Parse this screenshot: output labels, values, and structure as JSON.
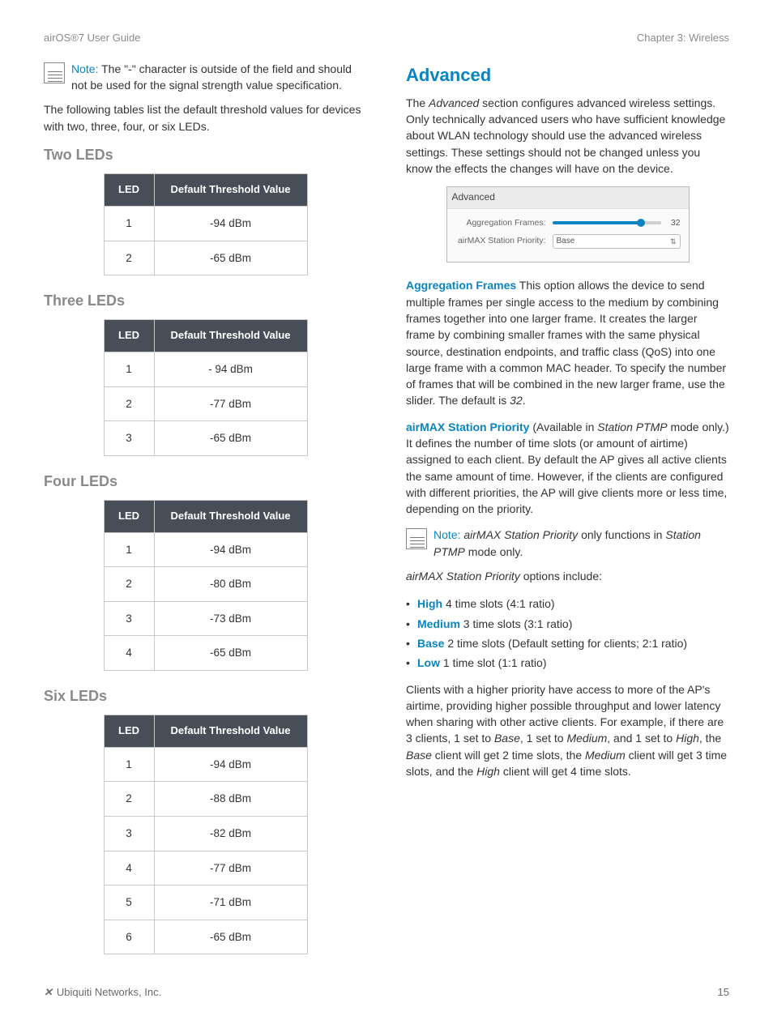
{
  "header": {
    "left": "airOS®7 User Guide",
    "right": "Chapter 3: Wireless"
  },
  "left": {
    "note1_label": "Note:",
    "note1": " The \"-\" character is outside of the field and should not be used for the signal strength value specification.",
    "intro": "The following tables list the default threshold values for devices with two, three, four, or six LEDs.",
    "two_title": "Two LEDs",
    "three_title": "Three LEDs",
    "four_title": "Four LEDs",
    "six_title": "Six LEDs",
    "col_led": "LED",
    "col_val": "Default Threshold Value",
    "two": [
      {
        "led": "1",
        "val": "-94 dBm"
      },
      {
        "led": "2",
        "val": "-65 dBm"
      }
    ],
    "three": [
      {
        "led": "1",
        "val": "- 94 dBm"
      },
      {
        "led": "2",
        "val": "-77 dBm"
      },
      {
        "led": "3",
        "val": "-65 dBm"
      }
    ],
    "four": [
      {
        "led": "1",
        "val": "-94 dBm"
      },
      {
        "led": "2",
        "val": "-80 dBm"
      },
      {
        "led": "3",
        "val": "-73 dBm"
      },
      {
        "led": "4",
        "val": "-65 dBm"
      }
    ],
    "six": [
      {
        "led": "1",
        "val": "-94 dBm"
      },
      {
        "led": "2",
        "val": "-88 dBm"
      },
      {
        "led": "3",
        "val": "-82 dBm"
      },
      {
        "led": "4",
        "val": "-77 dBm"
      },
      {
        "led": "5",
        "val": "-71 dBm"
      },
      {
        "led": "6",
        "val": "-65 dBm"
      }
    ]
  },
  "right": {
    "title": "Advanced",
    "intro_a": "The ",
    "intro_em": "Advanced",
    "intro_b": " section configures advanced wireless settings. Only technically advanced users who have sufficient knowledge about WLAN technology should use the advanced wireless settings. These settings should not be changed unless you know the effects the changes will have on the device.",
    "sc": {
      "title": "Advanced",
      "agg_label": "Aggregation Frames:",
      "agg_val": "32",
      "prio_label": "airMAX Station Priority:",
      "prio_val": "Base"
    },
    "agg_label": "Aggregation Frames",
    "agg_desc_a": "  This option allows the device to send multiple frames per single access to the medium by combining frames together into one larger frame. It creates the larger frame by combining smaller frames with the same physical source, destination endpoints, and traffic class (QoS) into one large frame with a common MAC header. To specify the number of frames that will be combined in the new larger frame, use the slider. The default is ",
    "agg_desc_em": "32",
    "agg_desc_b": ".",
    "prio_label": "airMAX Station Priority",
    "prio_desc_a": "  (Available in ",
    "prio_desc_em1": "Station PTMP",
    "prio_desc_b": " mode only.) It defines the number of time slots (or amount of airtime) assigned to each client. By default the AP gives all active clients the same amount of time. However, if the clients are configured with different priorities, the AP will give clients more or less time, depending on the priority.",
    "note2_label": "Note:",
    "note2_a": " ",
    "note2_em1": "airMAX Station Priority",
    "note2_b": " only functions in ",
    "note2_em2": "Station PTMP",
    "note2_c": " mode only.",
    "opts_intro_em": "airMAX Station Priority",
    "opts_intro_b": " options include:",
    "opts": {
      "high_l": "High",
      "high_t": "  4 time slots (4:1 ratio)",
      "med_l": "Medium",
      "med_t": "  3 time slots (3:1 ratio)",
      "base_l": "Base",
      "base_t": "  2 time slots (Default setting for clients; 2:1 ratio)",
      "low_l": "Low",
      "low_t": "  1 time slot (1:1 ratio)"
    },
    "closing_a": "Clients with a higher priority have access to more of the AP's airtime, providing higher possible throughput and lower latency when sharing with other active clients. For example, if there are 3 clients, 1 set to ",
    "closing_em1": "Base",
    "closing_b": ", 1 set to ",
    "closing_em2": "Medium",
    "closing_c": ", and 1 set to ",
    "closing_em3": "High",
    "closing_d": ", the ",
    "closing_em4": "Base",
    "closing_e": " client will get 2 time slots, the ",
    "closing_em5": "Medium",
    "closing_f": " client will get 3 time slots, and the ",
    "closing_em6": "High",
    "closing_g": " client will get 4 time slots."
  },
  "footer": {
    "company": "Ubiquiti Networks, Inc.",
    "page": "15"
  }
}
